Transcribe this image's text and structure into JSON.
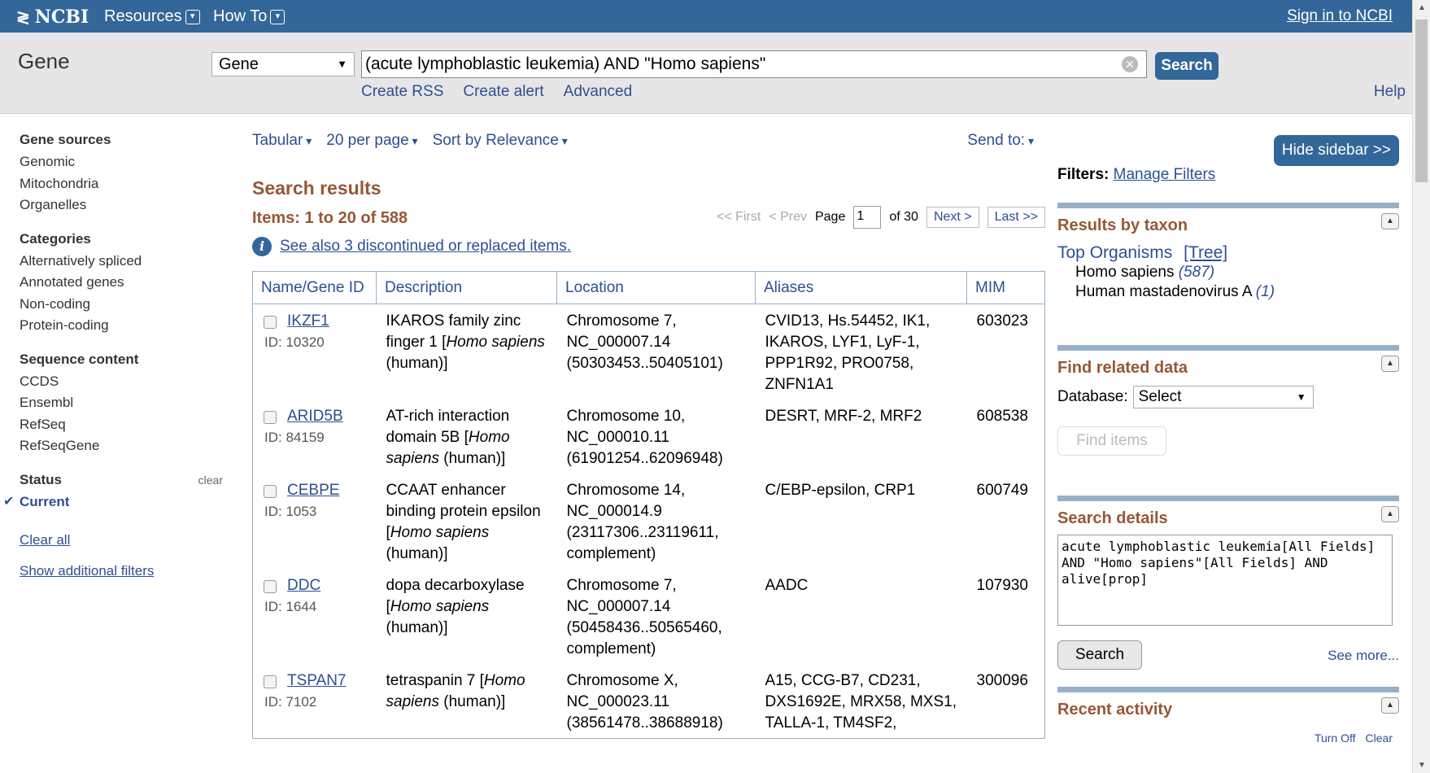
{
  "topbar": {
    "logo": "NCBI",
    "menus": [
      "Resources",
      "How To"
    ],
    "signin": "Sign in to NCBI"
  },
  "search": {
    "db_name": "Gene",
    "db_select": "Gene",
    "term": "(acute lymphoblastic leukemia) AND \"Homo sapiens\"",
    "button": "Search",
    "sublinks": [
      "Create RSS",
      "Create alert",
      "Advanced"
    ],
    "help": "Help"
  },
  "leftnav": {
    "gene_sources": {
      "heading": "Gene sources",
      "items": [
        "Genomic",
        "Mitochondria",
        "Organelles"
      ]
    },
    "categories": {
      "heading": "Categories",
      "items": [
        "Alternatively spliced",
        "Annotated genes",
        "Non-coding",
        "Protein-coding"
      ]
    },
    "sequence": {
      "heading": "Sequence content",
      "items": [
        "CCDS",
        "Ensembl",
        "RefSeq",
        "RefSeqGene"
      ]
    },
    "status": {
      "heading": "Status",
      "clear": "clear",
      "current": "Current"
    },
    "clear_all": "Clear all",
    "show_filters": "Show additional filters"
  },
  "main": {
    "toolbar": {
      "format": "Tabular",
      "per_page": "20 per page",
      "sort": "Sort by Relevance",
      "send_to": "Send to:"
    },
    "results_heading": "Search results",
    "items_text": "Items: 1 to 20 of 588",
    "pager": {
      "first": "<< First",
      "prev": "< Prev",
      "page_label": "Page",
      "page_value": "1",
      "of": "of 30",
      "next": "Next >",
      "last": "Last >>"
    },
    "see_also": "See also 3 discontinued or replaced items.",
    "columns": [
      "Name/Gene ID",
      "Description",
      "Location",
      "Aliases",
      "MIM"
    ],
    "rows": [
      {
        "name": "IKZF1",
        "id": "ID: 10320",
        "desc": "IKAROS family zinc finger 1 [",
        "species": "Homo sapiens",
        "desc_end": " (human)]",
        "loc": "Chromosome 7, NC_000007.14 (50303453..50405101)",
        "aliases": "CVID13, Hs.54452, IK1, IKAROS, LYF1, LyF-1, PPP1R92, PRO0758, ZNFN1A1",
        "mim": "603023"
      },
      {
        "name": "ARID5B",
        "id": "ID: 84159",
        "desc": "AT-rich interaction domain 5B [",
        "species": "Homo sapiens",
        "desc_end": " (human)]",
        "loc": "Chromosome 10, NC_000010.11 (61901254..62096948)",
        "aliases": "DESRT, MRF-2, MRF2",
        "mim": "608538"
      },
      {
        "name": "CEBPE",
        "id": "ID: 1053",
        "desc": "CCAAT enhancer binding protein epsilon [",
        "species": "Homo sapiens",
        "desc_end": " (human)]",
        "loc": "Chromosome 14, NC_000014.9 (23117306..23119611, complement)",
        "aliases": "C/EBP-epsilon, CRP1",
        "mim": "600749"
      },
      {
        "name": "DDC",
        "id": "ID: 1644",
        "desc": "dopa decarboxylase [",
        "species": "Homo sapiens",
        "desc_end": " (human)]",
        "loc": "Chromosome 7, NC_000007.14 (50458436..50565460, complement)",
        "aliases": "AADC",
        "mim": "107930"
      },
      {
        "name": "TSPAN7",
        "id": "ID: 7102",
        "desc": "tetraspanin 7 [",
        "species": "Homo sapiens",
        "desc_end": " (human)]",
        "loc": "Chromosome X, NC_000023.11 (38561478..38688918)",
        "aliases": "A15, CCG-B7, CD231, DXS1692E, MRX58, MXS1, TALLA-1, TM4SF2,",
        "mim": "300096"
      }
    ]
  },
  "rightbar": {
    "hide_sidebar": "Hide sidebar >>",
    "filters_label": "Filters:",
    "manage_filters": "Manage Filters",
    "taxon": {
      "heading": "Results by taxon",
      "top_organisms": "Top Organisms",
      "tree": "[Tree]",
      "organisms": [
        {
          "name": "Homo sapiens",
          "count": "(587)"
        },
        {
          "name": "Human mastadenovirus A",
          "count": "(1)"
        }
      ]
    },
    "related": {
      "heading": "Find related data",
      "db_label": "Database:",
      "db_value": "Select",
      "find": "Find items"
    },
    "details": {
      "heading": "Search details",
      "query": "acute lymphoblastic leukemia[All Fields] AND \"Homo sapiens\"[All Fields] AND alive[prop]",
      "search": "Search",
      "see_more": "See more..."
    },
    "recent": {
      "heading": "Recent activity",
      "turn_off": "Turn Off",
      "clear": "Clear"
    }
  }
}
